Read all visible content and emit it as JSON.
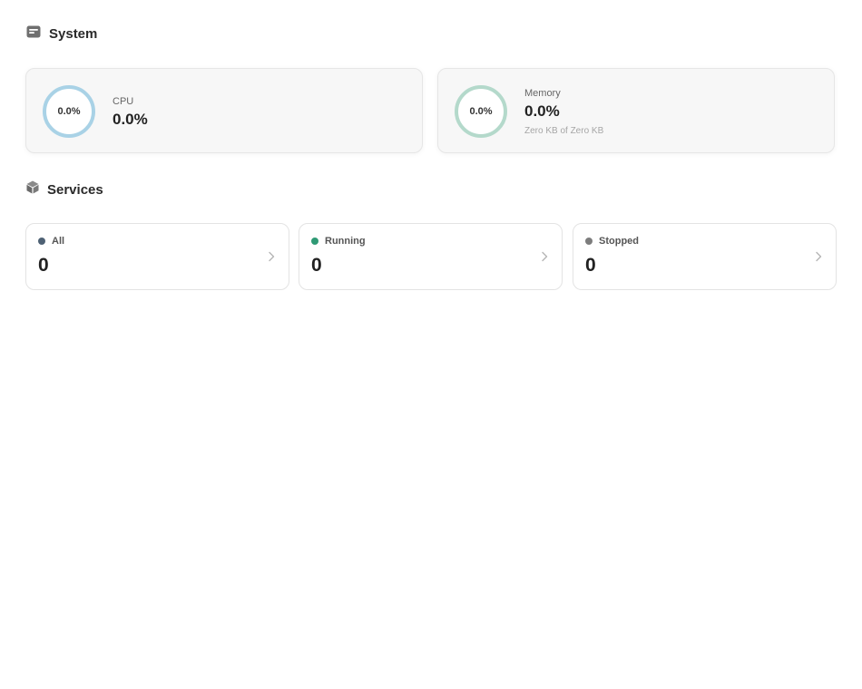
{
  "system": {
    "title": "System",
    "cpu": {
      "label": "CPU",
      "value": "0.0%",
      "ring_label": "0.0%",
      "ring_color": "#a9d2e6"
    },
    "memory": {
      "label": "Memory",
      "value": "0.0%",
      "ring_label": "0.0%",
      "detail": "Zero KB of Zero KB",
      "ring_color": "#b4d9cb"
    }
  },
  "services": {
    "title": "Services",
    "items": [
      {
        "label": "All",
        "count": "0",
        "dot_color": "#4e6174",
        "icon": "chevron-right-icon"
      },
      {
        "label": "Running",
        "count": "0",
        "dot_color": "#2f9a75",
        "icon": "chevron-right-icon"
      },
      {
        "label": "Stopped",
        "count": "0",
        "dot_color": "#7d7d7d",
        "icon": "chevron-right-icon"
      }
    ]
  },
  "icons": {
    "system": "system-window-icon",
    "services": "cube-icon"
  }
}
